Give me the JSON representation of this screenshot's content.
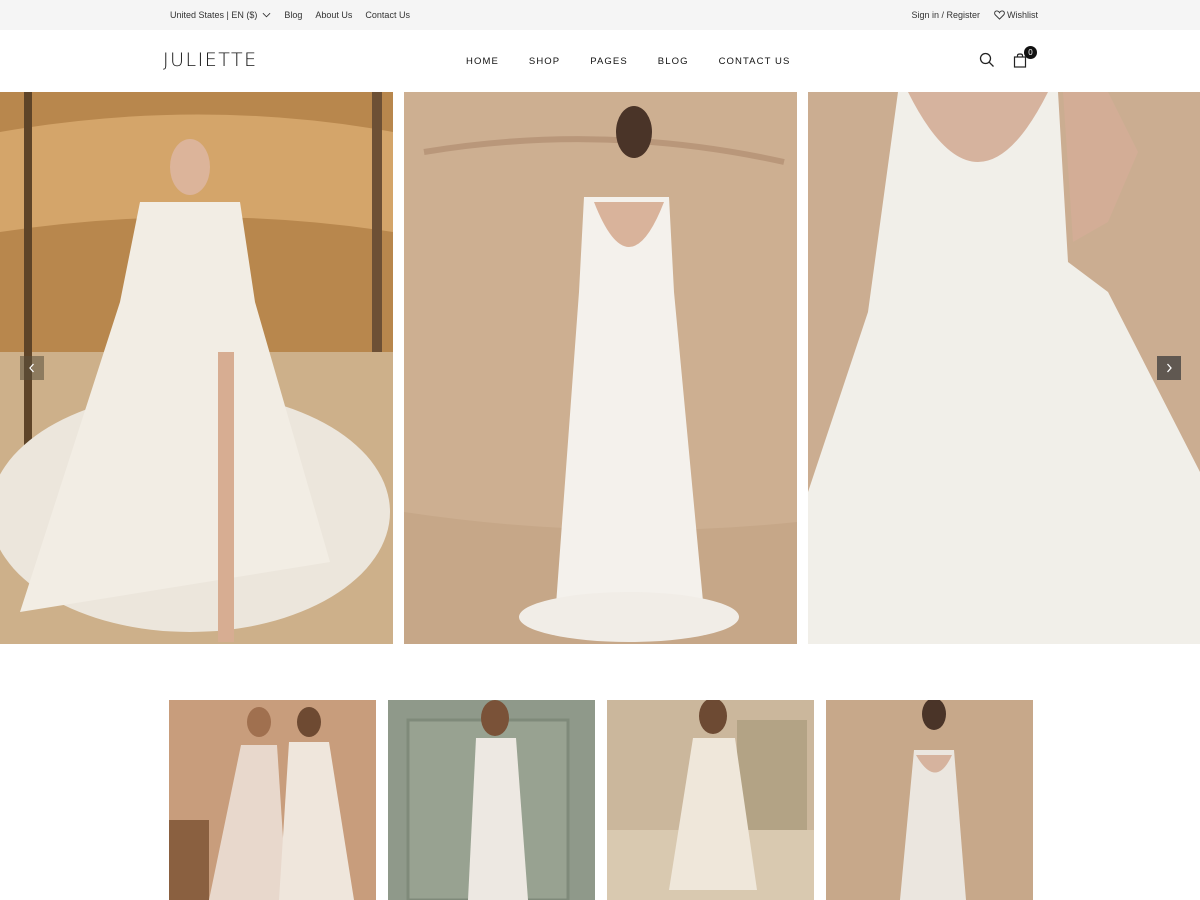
{
  "topbar": {
    "locale": "United States | EN ($)",
    "links": [
      "Blog",
      "About Us",
      "Contact Us"
    ],
    "account": "Sign in / Register",
    "wishlist": "Wishlist"
  },
  "header": {
    "logo": "JULIETTE",
    "nav": [
      "HOME",
      "SHOP",
      "PAGES",
      "BLOG",
      "CONTACT US"
    ],
    "cart_count": "0"
  },
  "icons": {
    "search": "search-icon",
    "cart": "shopping-bag-icon",
    "wishlist": "heart-icon",
    "slider_prev": "chevron-left-icon",
    "slider_next": "chevron-right-icon",
    "locale": "chevron-down-icon"
  },
  "colors": {
    "topbar_bg": "#f5f5f5",
    "text": "#111111",
    "badge": "#111111",
    "slider_arrow": "#3c3c3c"
  }
}
